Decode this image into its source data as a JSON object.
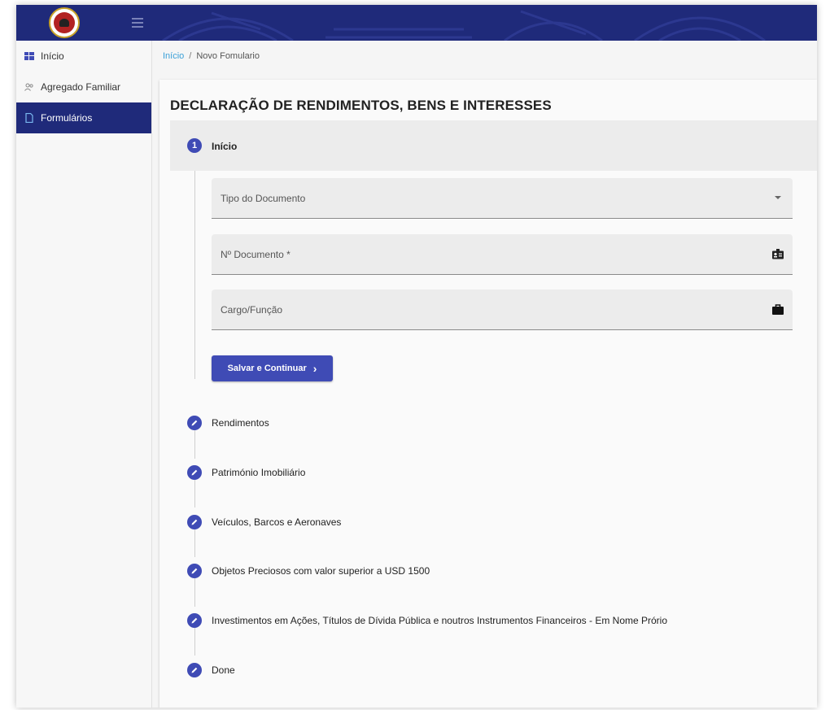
{
  "sidebar": {
    "items": [
      {
        "label": "Início",
        "icon": "grid-icon"
      },
      {
        "label": "Agregado Familiar",
        "icon": "people-icon"
      },
      {
        "label": "Formulários",
        "icon": "document-icon"
      }
    ]
  },
  "breadcrumb": {
    "home": "Início",
    "separator": "/",
    "current": "Novo Fomulario"
  },
  "form": {
    "title": "DECLARAÇÃO DE RENDIMENTOS, BENS E INTERESSES",
    "active_step": {
      "number": "1",
      "label": "Início"
    },
    "fields": {
      "tipo_documento": {
        "placeholder": "Tipo do Documento",
        "icon": "dropdown-arrow-icon"
      },
      "numero_documento": {
        "placeholder": "Nº Documento *",
        "icon": "id-card-icon"
      },
      "cargo": {
        "placeholder": "Cargo/Função",
        "icon": "briefcase-icon"
      }
    },
    "save_button": {
      "label": "Salvar e Continuar",
      "icon": "chevron-right-icon"
    },
    "steps": [
      {
        "label": "Rendimentos"
      },
      {
        "label": "Património Imobiliário"
      },
      {
        "label": "Veículos, Barcos e Aeronaves"
      },
      {
        "label": "Objetos Preciosos com valor superior a USD 1500"
      },
      {
        "label": "Investimentos em Ações, Títulos de Dívida Pública e noutros Instrumentos Financeiros - Em Nome Prório"
      },
      {
        "label": "Done"
      }
    ]
  },
  "colors": {
    "primary": "#3f4bb5",
    "topbar": "#1f2a7a",
    "link": "#3aa0d8"
  }
}
